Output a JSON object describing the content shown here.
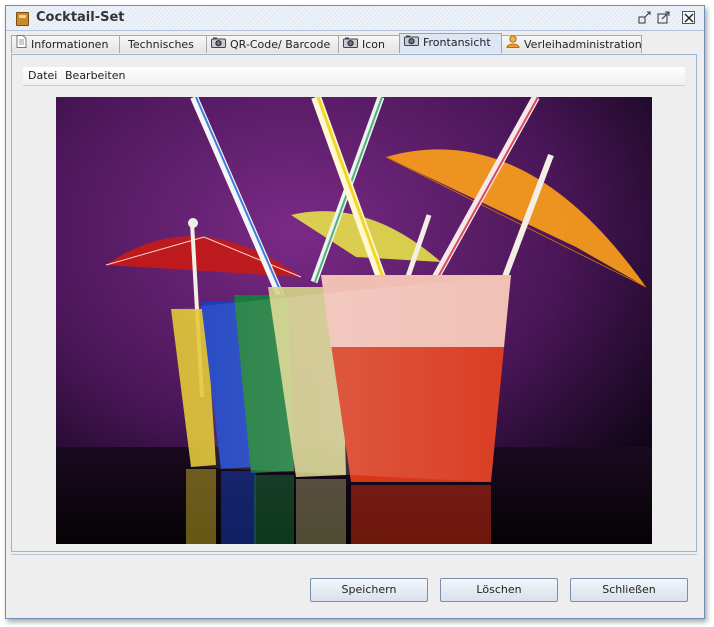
{
  "window": {
    "title": "Cocktail-Set",
    "controls": [
      "minimize-icon",
      "maximize-icon",
      "close-icon"
    ]
  },
  "tabs": [
    {
      "label": "Informationen",
      "icon": "document-icon",
      "active": false
    },
    {
      "label": "Technisches",
      "icon": "",
      "active": false
    },
    {
      "label": "QR-Code/ Barcode",
      "icon": "camera-icon",
      "active": false
    },
    {
      "label": "Icon",
      "icon": "camera-icon",
      "active": false
    },
    {
      "label": "Frontansicht",
      "icon": "camera-icon",
      "active": true
    },
    {
      "label": "Verleihadministration",
      "icon": "person-icon",
      "active": false
    }
  ],
  "menu": [
    {
      "label": "Datei"
    },
    {
      "label": "Bearbeiten"
    }
  ],
  "image": {
    "description_icon": "cocktail-photo"
  },
  "buttons": {
    "save": "Speichern",
    "delete": "Löschen",
    "close": "Schließen"
  },
  "colors": {
    "accent": "#9db3d4",
    "active_tab": "#dce6f4"
  }
}
